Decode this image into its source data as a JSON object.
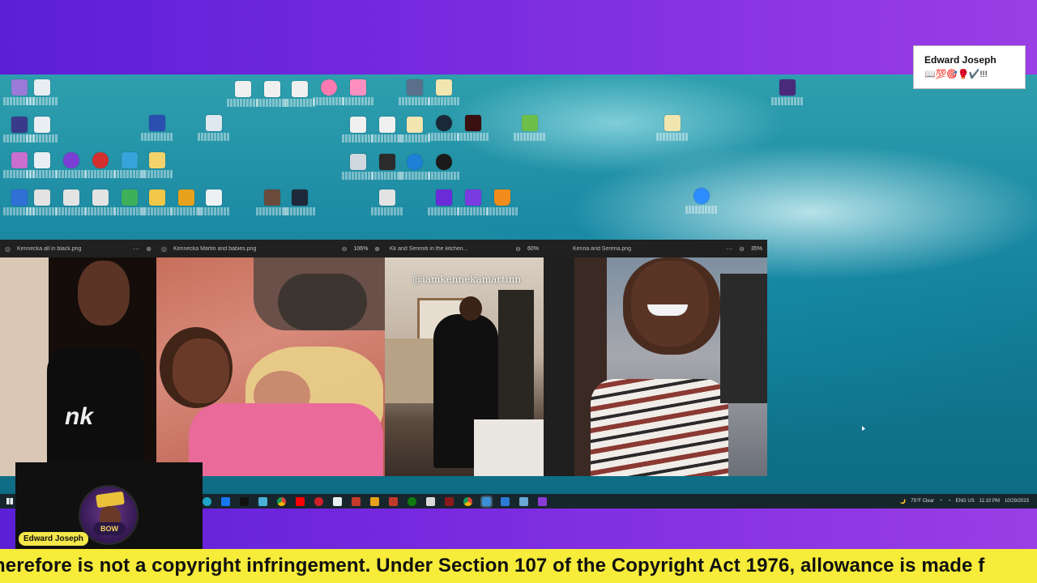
{
  "name_card": {
    "name": "Edward Joseph",
    "emoji_line": "📖💯🎯🥊✔️!!!"
  },
  "webcam": {
    "name_label": "Edward Joseph",
    "avatar_badge": "BOW"
  },
  "ticker": {
    "text": "herefore is not a copyright infringement. Under Section 107 of the Copyright Act 1976, allowance is made f"
  },
  "photo_viewers": [
    {
      "title": "Kennecka all in black.png",
      "zoom": ""
    },
    {
      "title": "Kennecka Martin and babies.png",
      "zoom": "106%"
    },
    {
      "title": "Kk and Sereniti in the kitchen...",
      "zoom": "60%"
    },
    {
      "title": "Kenna and Serena.png",
      "zoom": "35%"
    }
  ],
  "watermark_text": "@iamkennekamartinn",
  "tray": {
    "weather": "75°F  Clear",
    "lang": "ENG US",
    "time": "11:10 PM",
    "date": "10/29/2023"
  },
  "colors": {
    "ticker_bg": "#f6ec39",
    "page_bg_left": "#5b1fd6",
    "page_bg_right": "#9a3ee6",
    "taskbar_bg": "#17262c"
  }
}
